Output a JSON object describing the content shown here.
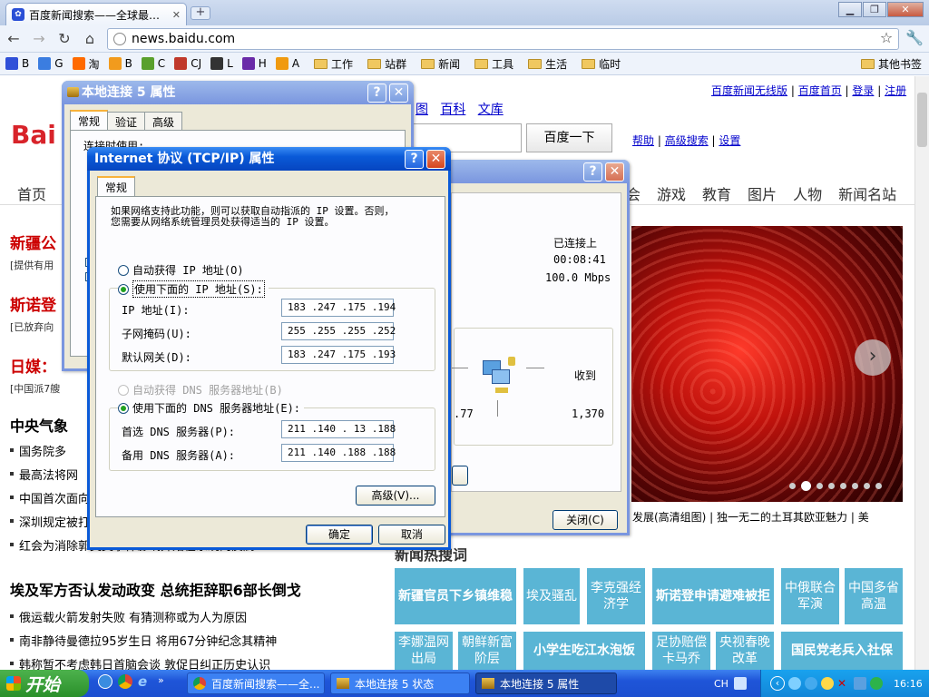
{
  "browser": {
    "tab_title": "百度新闻搜索——全球最…",
    "url": "news.baidu.com",
    "bookmarks": [
      {
        "label": "B",
        "color": "#3050d8"
      },
      {
        "label": "G",
        "color": "#3b7de0"
      },
      {
        "label": "淘",
        "color": "#ff6a00"
      },
      {
        "label": "B",
        "color": "#f29b1d"
      },
      {
        "label": "C",
        "color": "#5aa02c"
      },
      {
        "label": "CJ",
        "color": "#c0392b"
      },
      {
        "label": "L",
        "color": "#333333"
      },
      {
        "label": "H",
        "color": "#6a2ba8"
      },
      {
        "label": "A",
        "color": "#f09a10"
      }
    ],
    "folders": [
      "工作",
      "站群",
      "新闻",
      "工具",
      "生活",
      "临时"
    ],
    "other_bookmarks": "其他书签"
  },
  "page": {
    "top_links": [
      "百度新闻无线版",
      "百度首页",
      "登录",
      "注册"
    ],
    "search_links": [
      "图",
      "百科",
      "文库"
    ],
    "search_button": "百度一下",
    "help_links": [
      "帮助",
      "高级搜索",
      "设置"
    ],
    "nav_first": "首页",
    "nav_right": [
      "会",
      "游戏",
      "教育",
      "图片",
      "人物",
      "新闻名站"
    ],
    "logo": "Bai",
    "left_items": [
      {
        "text": "新疆公",
        "style": "red-head"
      },
      {
        "text": "[提供有用",
        "style": "small"
      },
      {
        "text": "斯诺登",
        "style": "red-head"
      },
      {
        "text": "[已放弃向",
        "style": "small"
      },
      {
        "text": "日媒：",
        "style": "red-head"
      },
      {
        "text": "[中国派7艘",
        "style": "small"
      },
      {
        "text": "中央气象",
        "style": "head"
      },
      {
        "text": "国务院多",
        "style": "bullet"
      },
      {
        "text": "最高法将网",
        "style": "bullet"
      },
      {
        "text": "中国首次面向",
        "style": "bullet"
      },
      {
        "text": "深圳规定被打",
        "style": "bullet"
      },
      {
        "text": "红会为消除郭美美事件影响开始在系统内反腐",
        "style": "bullet"
      }
    ],
    "headline2": "埃及军方否认发动政变 总统拒辞职6部长倒戈",
    "bullets2": [
      "俄运载火箭发射失败 有猜测称或为人为原因",
      "南非静待曼德拉95岁生日 将用67分钟纪念其精神",
      "韩称暂不考虑韩日首脑会谈 敦促日纠正历史认识"
    ],
    "photo_caption": "发展(高清组图)  |  独一无二的土耳其欧亚魅力  |  美",
    "hot_title": "新闻热搜词",
    "tiles": [
      "新疆官员下乡镇维稳",
      "埃及骚乱",
      "李克强经济学",
      "斯诺登申请避难被拒",
      "中俄联合军演",
      "中国多省高温",
      "李娜温网出局",
      "朝鲜新富阶层",
      "小学生吃江水泡饭",
      "足协赔偿卡马乔",
      "央视春晚改革",
      "国民党老兵入社保"
    ]
  },
  "dialog_status": {
    "status_value": "已连接上",
    "duration_value": "00:08:41",
    "speed_value": "100.0 Mbps",
    "received_label": "收到",
    "sent_value": ".77",
    "received_value": "1,370",
    "close_button": "关闭(C)"
  },
  "dialog_props": {
    "title": "本地连接 5 属性",
    "tabs": [
      "常规",
      "验证",
      "高级"
    ],
    "connect_using": "连接时使用:"
  },
  "dialog_tcpip": {
    "title": "Internet 协议 (TCP/IP) 属性",
    "tab": "常规",
    "description": "如果网络支持此功能，则可以获取自动指派的 IP 设置。否则，\n您需要从网络系统管理员处获得适当的 IP 设置。",
    "auto_ip": "自动获得 IP 地址(O)",
    "manual_ip": "使用下面的 IP 地址(S):",
    "ip_label": "IP 地址(I):",
    "ip_value": "183 .247 .175 .194",
    "mask_label": "子网掩码(U):",
    "mask_value": "255 .255 .255 .252",
    "gateway_label": "默认网关(D):",
    "gateway_value": "183 .247 .175 .193",
    "auto_dns": "自动获得 DNS 服务器地址(B)",
    "manual_dns": "使用下面的 DNS 服务器地址(E):",
    "dns1_label": "首选 DNS 服务器(P):",
    "dns1_value": "211 .140 . 13 .188",
    "dns2_label": "备用 DNS 服务器(A):",
    "dns2_value": "211 .140 .188 .188",
    "advanced_button": "高级(V)...",
    "ok_button": "确定",
    "cancel_button": "取消"
  },
  "taskbar": {
    "start": "开始",
    "items": [
      "百度新闻搜索——全...",
      "本地连接 5 状态",
      "本地连接 5 属性"
    ],
    "lang": "CH",
    "clock": "16:16"
  }
}
